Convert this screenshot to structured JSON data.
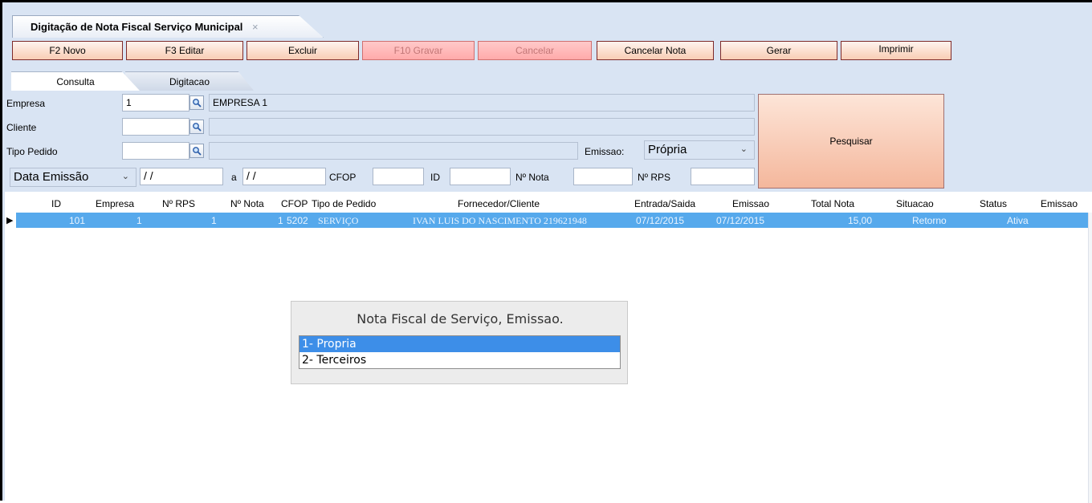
{
  "window": {
    "title": "Digitação de Nota Fiscal Serviço Municipal",
    "close": "×"
  },
  "toolbar": {
    "buttons": [
      "F2 Novo",
      "F3 Editar",
      "Excluir",
      "F10 Gravar",
      "Cancelar",
      "Cancelar Nota",
      "Gerar",
      "Imprimir"
    ]
  },
  "tabs": [
    "Consulta",
    "Digitacao"
  ],
  "filters": {
    "empresa_label": "Empresa",
    "empresa_code": "1",
    "empresa_name": "EMPRESA 1",
    "cliente_label": "Cliente",
    "tipo_pedido_label": "Tipo Pedido",
    "emissao_label": "Emissao:",
    "emissao_value": "Própria",
    "date_field": "Data Emissão",
    "date_from": "/ /",
    "a_label": "a",
    "date_to": "/ /",
    "cfop_label": "CFOP",
    "id_label": "ID",
    "nota_label": "Nº Nota",
    "rps_label": "Nº RPS",
    "search_label": "Pesquisar"
  },
  "grid": {
    "columns": [
      "ID",
      "Empresa",
      "Nº RPS",
      "Nº Nota",
      "CFOP",
      "Tipo de Pedido",
      "Fornecedor/Cliente",
      "Entrada/Saida",
      "Emissao",
      "Total Nota",
      "Situacao",
      "Status",
      "Emissao"
    ],
    "rows": [
      [
        "101",
        "1",
        "1",
        "1",
        "5202",
        "SERVIÇO",
        "IVAN LUIS DO NASCIMENTO 219621948",
        "07/12/2015",
        "07/12/2015",
        "15,00",
        "Retorno",
        "Ativa",
        ""
      ]
    ]
  },
  "popup": {
    "title": "Nota Fiscal de Serviço, Emissao.",
    "options": [
      "1- Propria",
      "2- Terceiros"
    ]
  },
  "colors": {
    "accent": "#56a9ec",
    "background": "#d9e4f3",
    "button": "#f8cdb4"
  }
}
